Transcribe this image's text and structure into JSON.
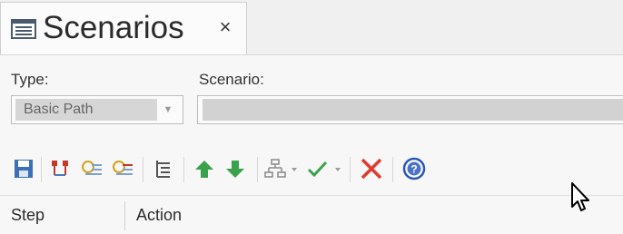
{
  "tab": {
    "title": "Scenarios",
    "close_glyph": "×",
    "icon": "document-list-icon"
  },
  "form": {
    "type_label": "Type:",
    "type_value": "Basic Path",
    "scenario_label": "Scenario:",
    "scenario_value": ""
  },
  "toolbar": {
    "buttons": [
      {
        "name": "save-icon",
        "color": "#3b6fb6"
      },
      {
        "name": "structure-icon",
        "color": "#c0392b"
      },
      {
        "name": "add-alternate-icon",
        "color": "#d4a017"
      },
      {
        "name": "add-exception-icon",
        "color": "#d4a017"
      },
      {
        "name": "indent-tree-icon",
        "color": "#555555"
      },
      {
        "name": "move-up-icon",
        "color": "#3aa24a"
      },
      {
        "name": "move-down-icon",
        "color": "#3aa24a"
      },
      {
        "name": "generate-diagram-icon",
        "color": "#888888"
      },
      {
        "name": "validate-icon",
        "color": "#3aa24a"
      },
      {
        "name": "delete-icon",
        "color": "#e03c31"
      },
      {
        "name": "help-icon",
        "color": "#2a57b8"
      }
    ]
  },
  "grid": {
    "columns": [
      "Step",
      "Action"
    ]
  }
}
